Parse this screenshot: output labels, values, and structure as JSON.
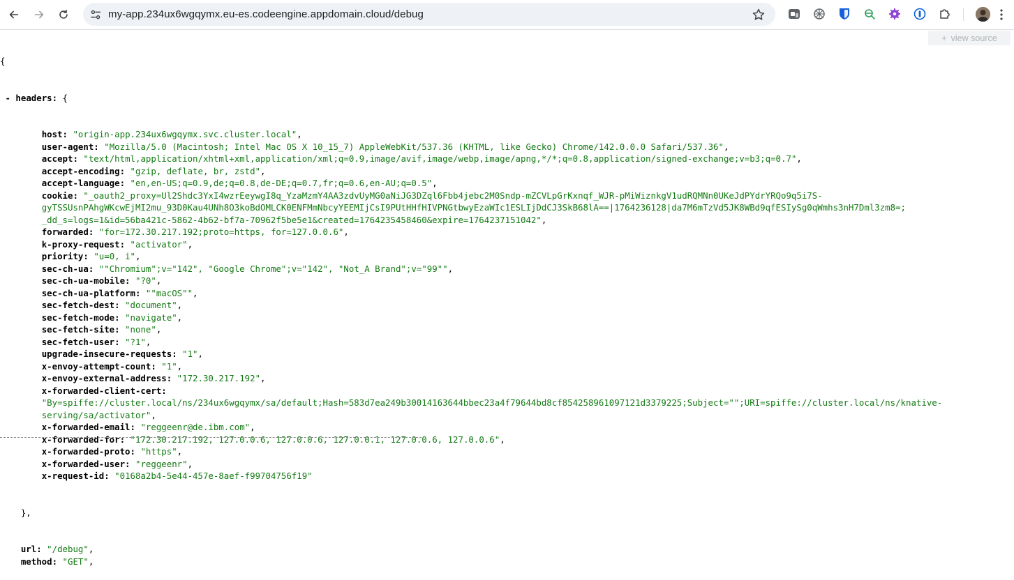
{
  "browser": {
    "url": "my-app.234ux6wgqymx.eu-es.codeengine.appdomain.cloud/debug"
  },
  "viewer": {
    "view_source_label": "view source"
  },
  "json": {
    "open_brace": "{",
    "headers_key": "headers",
    "headers_open": "{",
    "entries": [
      {
        "key": "host",
        "value": "\"origin-app.234ux6wgqymx.svc.cluster.local\""
      },
      {
        "key": "user-agent",
        "value": "\"Mozilla/5.0 (Macintosh; Intel Mac OS X 10_15_7) AppleWebKit/537.36 (KHTML, like Gecko) Chrome/142.0.0.0 Safari/537.36\""
      },
      {
        "key": "accept",
        "value": "\"text/html,application/xhtml+xml,application/xml;q=0.9,image/avif,image/webp,image/apng,*/*;q=0.8,application/signed-exchange;v=b3;q=0.7\""
      },
      {
        "key": "accept-encoding",
        "value": "\"gzip, deflate, br, zstd\""
      },
      {
        "key": "accept-language",
        "value": "\"en,en-US;q=0.9,de;q=0.8,de-DE;q=0.7,fr;q=0.6,en-AU;q=0.5\""
      },
      {
        "key": "cookie",
        "value": "\"_oauth2_proxy=Ul2Shdc3YxI4wzrEeywgI8q_YzaMzmY4AA3zdvUyMG0aNiJG3DZql6Fbb4jebc2M0Sndp-mZCVLpGrKxnqf_WJR-pMiWiznkgV1udRQMNn0UKeJdPYdrYRQo9q5i7S-",
        "cont": [
          "gyTSSUsnPAhgWKcwEjMI2mu_93D0Kau4UNh8O3koBdOMLCK0ENFMmNbcyYEEMIjCsI9PUtHHfHIVPNGtbwyEzaWIc1ESLIjDdCJ3SkB68lA==|1764236128|da7M6mTzVd5JK8WBd9qfESIySg0qWmhs3nH7Dml3zm8=;",
          "_dd_s=logs=1&id=56ba421c-5862-4b62-bf7a-70962f5be5e1&created=1764235458460&expire=1764237151042\""
        ]
      },
      {
        "key": "forwarded",
        "value": "\"for=172.30.217.192;proto=https, for=127.0.0.6\""
      },
      {
        "key": "k-proxy-request",
        "value": "\"activator\""
      },
      {
        "key": "priority",
        "value": "\"u=0, i\""
      },
      {
        "key": "sec-ch-ua",
        "value": "\"\"Chromium\";v=\"142\", \"Google Chrome\";v=\"142\", \"Not_A Brand\";v=\"99\"\""
      },
      {
        "key": "sec-ch-ua-mobile",
        "value": "\"?0\""
      },
      {
        "key": "sec-ch-ua-platform",
        "value": "\"\"macOS\"\""
      },
      {
        "key": "sec-fetch-dest",
        "value": "\"document\""
      },
      {
        "key": "sec-fetch-mode",
        "value": "\"navigate\""
      },
      {
        "key": "sec-fetch-site",
        "value": "\"none\""
      },
      {
        "key": "sec-fetch-user",
        "value": "\"?1\""
      },
      {
        "key": "upgrade-insecure-requests",
        "value": "\"1\""
      },
      {
        "key": "x-envoy-attempt-count",
        "value": "\"1\""
      },
      {
        "key": "x-envoy-external-address",
        "value": "\"172.30.217.192\""
      },
      {
        "key": "x-forwarded-client-cert",
        "value": "",
        "cont": [
          "\"By=spiffe://cluster.local/ns/234ux6wgqymx/sa/default;Hash=583d7ea249b30014163644bbec23a4f79644bd8cf854258961097121d3379225;Subject=\"\";URI=spiffe://cluster.local/ns/knative-",
          "serving/sa/activator\""
        ]
      },
      {
        "key": "x-forwarded-email",
        "value": "\"reggeenr@de.ibm.com\""
      },
      {
        "key": "x-forwarded-for",
        "value": "\"172.30.217.192, 127.0.0.6, 127.0.0.6, 127.0.0.1, 127.0.0.6, 127.0.0.6\""
      },
      {
        "key": "x-forwarded-proto",
        "value": "\"https\""
      },
      {
        "key": "x-forwarded-user",
        "value": "\"reggeenr\""
      },
      {
        "key": "x-request-id",
        "value": "\"0168a2b4-5e44-457e-8aef-f99704756f19\"",
        "last": true
      }
    ],
    "headers_close": "},",
    "tail": [
      {
        "key": "url",
        "value": "\"/debug\""
      },
      {
        "key": "method",
        "value": "\"GET\""
      }
    ]
  }
}
